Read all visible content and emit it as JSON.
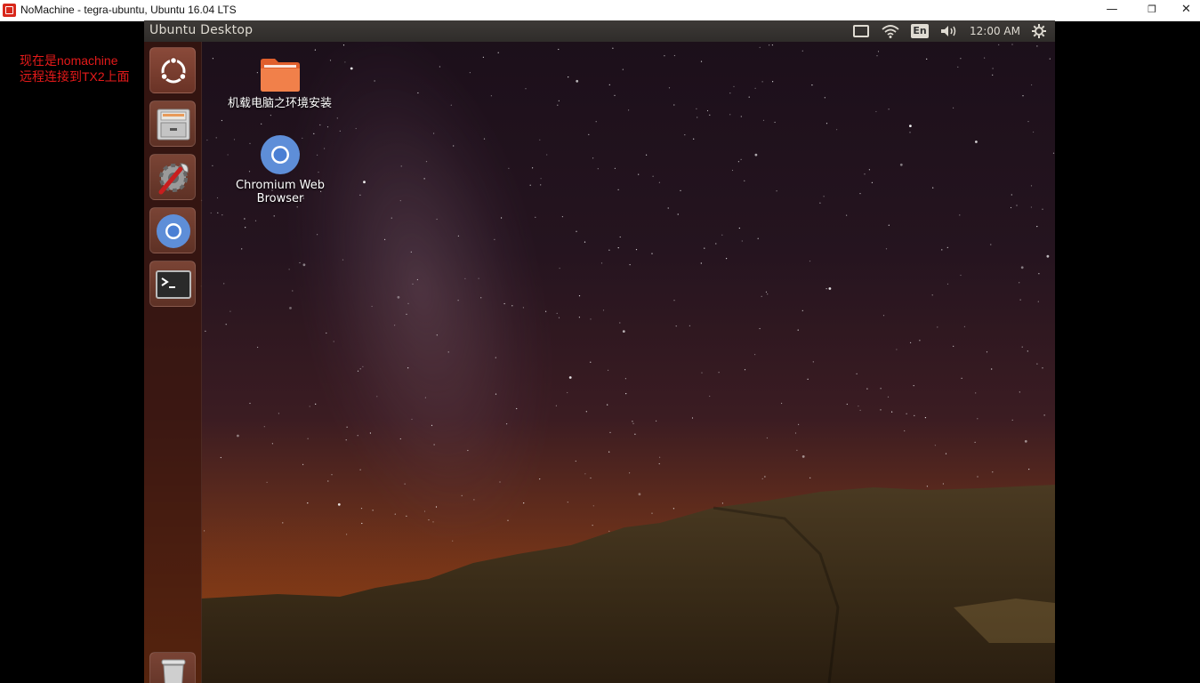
{
  "window": {
    "title": "NoMachine - tegra-ubuntu, Ubuntu 16.04 LTS",
    "minimize": "—",
    "maximize": "❐",
    "close": "✕"
  },
  "annotation": {
    "line1": "现在是nomachine",
    "line2": "远程连接到TX2上面",
    "color": "#e41a1a"
  },
  "panel": {
    "title": "Ubuntu Desktop",
    "language": "En",
    "clock": "12:00 AM",
    "icons": [
      "nomachine-icon",
      "wifi-icon",
      "keyboard-language-icon",
      "volume-icon",
      "settings-gear-icon"
    ]
  },
  "launcher": {
    "items": [
      {
        "name": "ubuntu-dash-icon"
      },
      {
        "name": "files-icon"
      },
      {
        "name": "system-settings-icon"
      },
      {
        "name": "chromium-icon"
      },
      {
        "name": "terminal-icon"
      },
      {
        "name": "trash-icon"
      }
    ]
  },
  "desktop": {
    "icons": [
      {
        "label": "机载电脑之环境安装",
        "icon": "folder-icon"
      },
      {
        "label": "Chromium Web Browser",
        "icon": "chromium-icon"
      }
    ]
  }
}
